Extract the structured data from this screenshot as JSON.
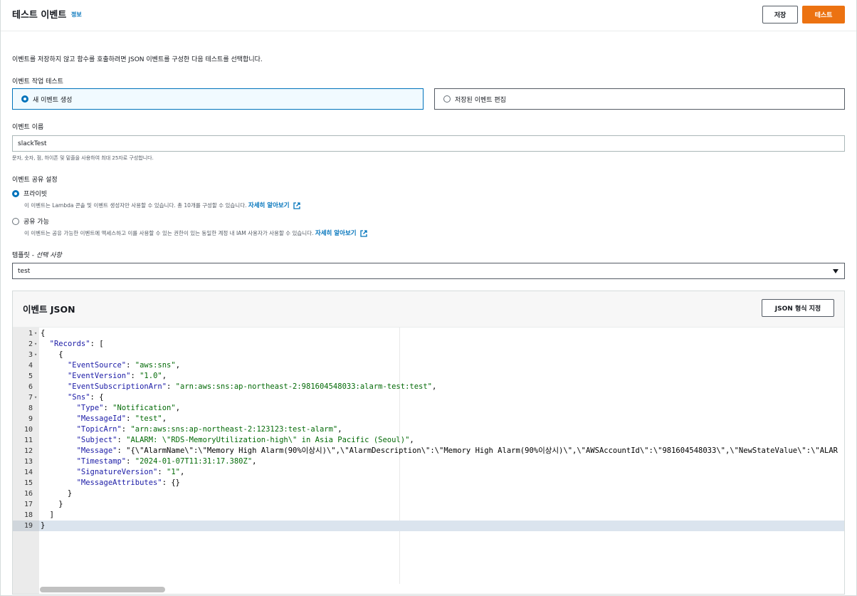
{
  "header": {
    "title": "테스트 이벤트",
    "info": "정보",
    "save_label": "저장",
    "test_label": "테스트"
  },
  "description": "이벤트를 저장하지 않고 함수를 호출하려면 JSON 이벤트를 구성한 다음 테스트를 선택합니다.",
  "action": {
    "label": "이벤트 작업 테스트",
    "options": [
      "새 이벤트 생성",
      "저장된 이벤트 편집"
    ],
    "selected": "새 이벤트 생성"
  },
  "event_name": {
    "label": "이벤트 이름",
    "value": "slackTest",
    "hint": "문자, 숫자, 점, 하이픈 및 밑줄을 사용하여 최대 25자로 구성합니다."
  },
  "sharing": {
    "label": "이벤트 공유 설정",
    "private_label": "프라이빗",
    "private_desc": "이 이벤트는 Lambda 콘솔 및 이벤트 생성자만 사용할 수 있습니다. 총 10개를 구성할 수 있습니다.",
    "shareable_label": "공유 가능",
    "shareable_desc": "이 이벤트는 공유 가능한 이벤트에 액세스하고 이를 사용할 수 있는 권한이 있는 동일한 계정 내 IAM 사용자가 사용할 수 있습니다.",
    "learn_more": "자세히 알아보기",
    "selected": "프라이빗"
  },
  "template": {
    "label": "템플릿 - ",
    "label_optional": "선택 사항",
    "value": "test"
  },
  "json_panel": {
    "title": "이벤트 JSON",
    "format_label": "JSON 형식 지정",
    "active_line": 19,
    "lines": [
      "{",
      "  \"Records\": [",
      "    {",
      "      \"EventSource\": \"aws:sns\",",
      "      \"EventVersion\": \"1.0\",",
      "      \"EventSubscriptionArn\": \"arn:aws:sns:ap-northeast-2:981604548033:alarm-test:test\",",
      "      \"Sns\": {",
      "        \"Type\": \"Notification\",",
      "        \"MessageId\": \"test\",",
      "        \"TopicArn\": \"arn:aws:sns:ap-northeast-2:123123:test-alarm\",",
      "        \"Subject\": \"ALARM: \\\"RDS-MemoryUtilization-high\\\" in Asia Pacific (Seoul)\",",
      "        \"Message\": \"{\\\"AlarmName\\\":\\\"Memory High Alarm(90%이상시)\\\",\\\"AlarmDescription\\\":\\\"Memory High Alarm(90%이상시)\\\",\\\"AWSAccountId\\\":\\\"981604548033\\\",\\\"NewStateValue\\\":\\\"ALAR",
      "        \"Timestamp\": \"2024-01-07T11:31:17.380Z\",",
      "        \"SignatureVersion\": \"1\",",
      "        \"MessageAttributes\": {}",
      "      }",
      "    }",
      "  ]",
      "}"
    ],
    "foldable_lines": [
      1,
      2,
      3,
      7
    ]
  }
}
